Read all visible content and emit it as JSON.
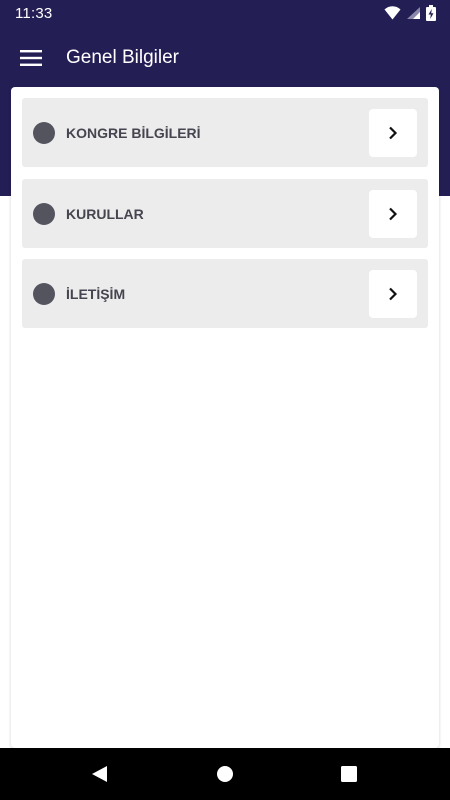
{
  "status_bar": {
    "time": "11:33",
    "icons": [
      "wifi-icon",
      "signal-icon",
      "battery-charging-icon"
    ]
  },
  "app_bar": {
    "title": "Genel Bilgiler",
    "menu_icon": "hamburger-menu-icon"
  },
  "items": [
    {
      "label": "KONGRE BİLGİLERİ",
      "icon": "dot-icon",
      "action_icon": "chevron-right-icon"
    },
    {
      "label": "KURULLAR",
      "icon": "dot-icon",
      "action_icon": "chevron-right-icon"
    },
    {
      "label": "İLETİŞİM",
      "icon": "dot-icon",
      "action_icon": "chevron-right-icon"
    }
  ],
  "nav_bar": {
    "buttons": [
      "back-icon",
      "home-icon",
      "recents-icon"
    ]
  },
  "colors": {
    "primary": "#231f55",
    "item_background": "#ececec",
    "dot": "#54545f",
    "label": "#45454f"
  }
}
